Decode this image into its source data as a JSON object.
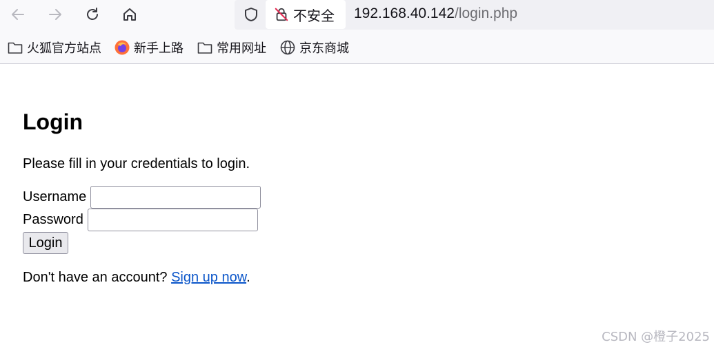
{
  "browser": {
    "insecure_label": "不安全",
    "url_host": "192.168.40.142",
    "url_path": "/login.php",
    "icons": [
      "back-icon",
      "forward-icon",
      "reload-icon",
      "home-icon",
      "shield-icon",
      "insecure-lock-icon"
    ]
  },
  "bookmarks": [
    {
      "label": "火狐官方站点",
      "icon": "folder-icon"
    },
    {
      "label": "新手上路",
      "icon": "firefox-icon"
    },
    {
      "label": "常用网址",
      "icon": "folder-icon"
    },
    {
      "label": "京东商城",
      "icon": "globe-icon"
    }
  ],
  "page": {
    "title": "Login",
    "intro": "Please fill in your credentials to login.",
    "username_label": "Username",
    "username_value": "",
    "password_label": "Password",
    "password_value": "",
    "login_button": "Login",
    "signup_prefix": "Don't have an account? ",
    "signup_link": "Sign up now",
    "signup_suffix": "."
  },
  "watermark": "CSDN @橙子2025",
  "colors": {
    "link": "#0a55c9",
    "toolbar_bg": "#f9f9fb",
    "urlbar_bg": "#f0f0f4"
  }
}
